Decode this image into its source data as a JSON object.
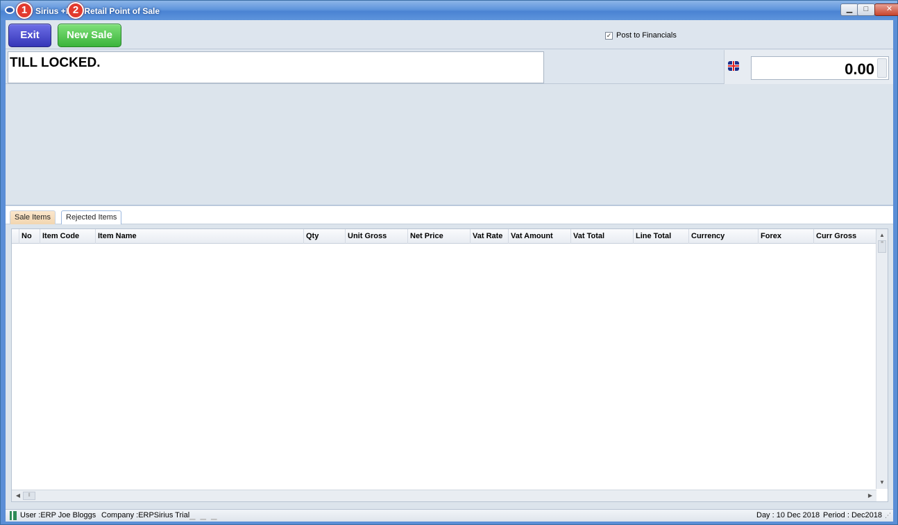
{
  "window": {
    "title": "Sirius +Dte: Retail Point of Sale",
    "controls": {
      "minimize": "▁",
      "maximize": "□",
      "close": "✕"
    }
  },
  "annotations": [
    "1",
    "2"
  ],
  "toolbar": {
    "exit_label": "Exit",
    "new_sale_label": "New Sale",
    "post_to_financials_label": "Post to Financials",
    "post_to_financials_checked": true,
    "check_glyph": "✓"
  },
  "till": {
    "status_text": "TILL LOCKED.",
    "amount": "0.00",
    "currency_icon": "uk-flag-icon"
  },
  "tabs": [
    {
      "label": "Sale Items",
      "active": false
    },
    {
      "label": "Rejected Items",
      "active": true
    }
  ],
  "grid": {
    "columns": [
      "No",
      "Item Code",
      "Item Name",
      "Qty",
      "Unit Gross",
      "Net Price",
      "Vat Rate",
      "Vat Amount",
      "Vat Total",
      "Line Total",
      "Currency",
      "Forex",
      "Curr Gross"
    ],
    "rows": []
  },
  "statusbar": {
    "user": "User :ERP Joe Bloggs",
    "company": "Company :ERPSirius Trial",
    "day": "Day : 10 Dec 2018",
    "period": "Period : Dec2018"
  },
  "colors": {
    "exit_button": "#3f40c6",
    "new_sale_button": "#46bf44",
    "titlebar": "#5f95dc",
    "badge": "#e23a2e",
    "panel_background": "#dce4ec"
  }
}
